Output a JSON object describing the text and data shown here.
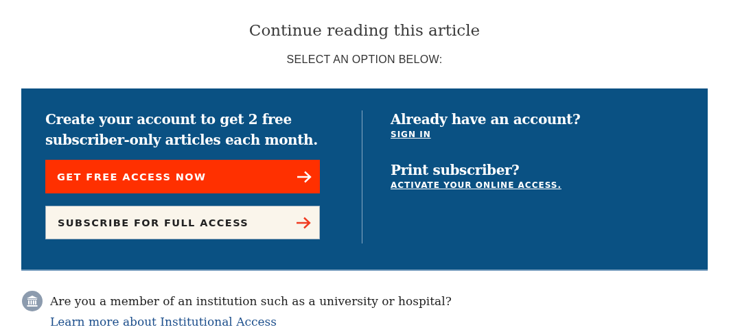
{
  "title": "Continue reading this article",
  "subtitle": "SELECT AN OPTION BELOW:",
  "offer": {
    "heading": "Create your account to get 2 free subscriber-only articles each month.",
    "buttons": [
      {
        "label": "GET FREE ACCESS NOW",
        "kind": "primary"
      },
      {
        "label": "SUBSCRIBE FOR FULL ACCESS",
        "kind": "secondary"
      }
    ]
  },
  "options": [
    {
      "heading": "Already have an account?",
      "link": "SIGN IN"
    },
    {
      "heading": "Print subscriber?",
      "link": "ACTIVATE YOUR ONLINE ACCESS."
    }
  ],
  "institution": {
    "question": "Are you a member of an institution such as a university or hospital?",
    "link": "Learn more about Institutional Access"
  }
}
